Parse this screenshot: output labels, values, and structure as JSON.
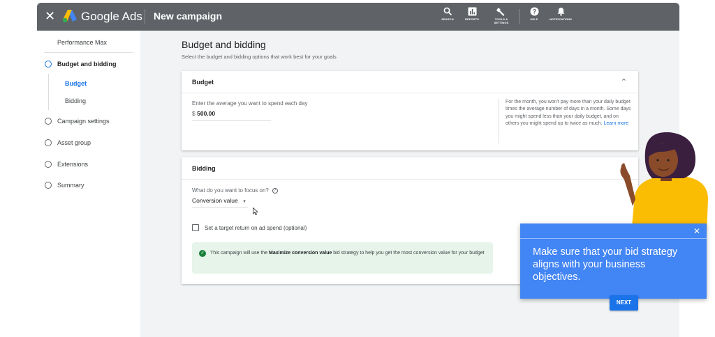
{
  "topbar": {
    "brand": "Google Ads",
    "title": "New campaign",
    "tools": [
      {
        "icon": "search-icon",
        "label": "SEARCH"
      },
      {
        "icon": "reports-icon",
        "label": "REPORTS"
      },
      {
        "icon": "wrench-icon",
        "label": "TOOLS & SETTINGS"
      },
      {
        "icon": "help-icon",
        "label": "HELP"
      },
      {
        "icon": "bell-icon",
        "label": "NOTIFICATIONS"
      }
    ]
  },
  "sidebar": {
    "campaign_type": "Performance Max",
    "items": [
      {
        "label": "Budget and bidding",
        "active": true
      },
      {
        "label": "Campaign settings",
        "active": false
      },
      {
        "label": "Asset group",
        "active": false
      },
      {
        "label": "Extensions",
        "active": false
      },
      {
        "label": "Summary",
        "active": false
      }
    ],
    "subitems": [
      {
        "label": "Budget",
        "active": true
      },
      {
        "label": "Bidding",
        "active": false
      }
    ]
  },
  "main": {
    "title": "Budget and bidding",
    "subtitle": "Select the budget and bidding options that work best for your goals"
  },
  "budget": {
    "header": "Budget",
    "field_label": "Enter the average you want to spend each day",
    "currency": "$",
    "value": "500.00",
    "side_note": "For the month, you won't pay more than your daily budget times the average number of days in a month. Some days you might spend less than your daily budget, and on others you might spend up to twice as much.",
    "learn_more": "Learn more"
  },
  "bidding": {
    "header": "Bidding",
    "question": "What do you want to focus on?",
    "focus_value": "Conversion value",
    "checkbox_label": "Set a target return on ad spend (optional)",
    "checkbox_checked": false,
    "info_pre": "This campaign will use the",
    "info_bold": "Maximize conversion value",
    "info_post": "bid strategy to help you get the most conversion value for your budget"
  },
  "tooltip": {
    "message": "Make sure that your bid strategy aligns with your business objectives.",
    "next_label": "NEXT"
  },
  "colors": {
    "topbar": "#5f6368",
    "accent": "#1a73e8",
    "tooltip": "#4285f4",
    "success_bg": "#e6f4ea",
    "success_icon": "#188038"
  }
}
